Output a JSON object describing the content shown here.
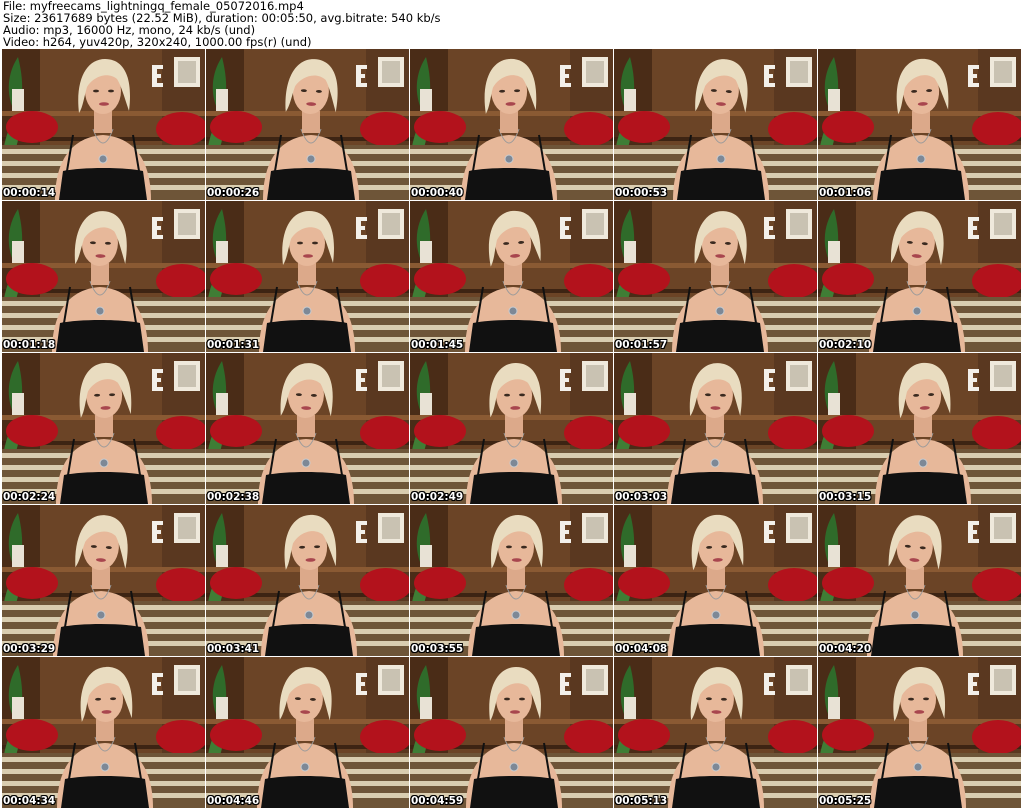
{
  "header": {
    "file_line": "File: myfreecams_lightningq_female_05072016.mp4",
    "size_line": "Size: 23617689 bytes (22.52 MiB), duration: 00:05:50, avg.bitrate: 540 kb/s",
    "audio_line": "Audio: mp3, 16000 Hz, mono, 24 kb/s (und)",
    "video_line": "Video: h264, yuv420p, 320x240, 1000.00 fps(r) (und)"
  },
  "thumbnails": [
    {
      "timestamp": "00:00:14"
    },
    {
      "timestamp": "00:00:26"
    },
    {
      "timestamp": "00:00:40"
    },
    {
      "timestamp": "00:00:53"
    },
    {
      "timestamp": "00:01:06"
    },
    {
      "timestamp": "00:01:18"
    },
    {
      "timestamp": "00:01:31"
    },
    {
      "timestamp": "00:01:45"
    },
    {
      "timestamp": "00:01:57"
    },
    {
      "timestamp": "00:02:10"
    },
    {
      "timestamp": "00:02:24"
    },
    {
      "timestamp": "00:02:38"
    },
    {
      "timestamp": "00:02:49"
    },
    {
      "timestamp": "00:03:03"
    },
    {
      "timestamp": "00:03:15"
    },
    {
      "timestamp": "00:03:29"
    },
    {
      "timestamp": "00:03:41"
    },
    {
      "timestamp": "00:03:55"
    },
    {
      "timestamp": "00:04:08"
    },
    {
      "timestamp": "00:04:20"
    },
    {
      "timestamp": "00:04:34"
    },
    {
      "timestamp": "00:04:46"
    },
    {
      "timestamp": "00:04:59"
    },
    {
      "timestamp": "00:05:13"
    },
    {
      "timestamp": "00:05:25"
    }
  ],
  "colors": {
    "wall": "#6b4426",
    "shelf": "#8a5a33",
    "heart": "#b3121c",
    "plant": "#2f6b2a",
    "hair": "#e9dcc0",
    "skin": "#e7b89a",
    "dress": "#111111",
    "stripe_light": "#d9cdb0",
    "stripe_dark": "#6e5538",
    "frame": "#efe9dc"
  }
}
